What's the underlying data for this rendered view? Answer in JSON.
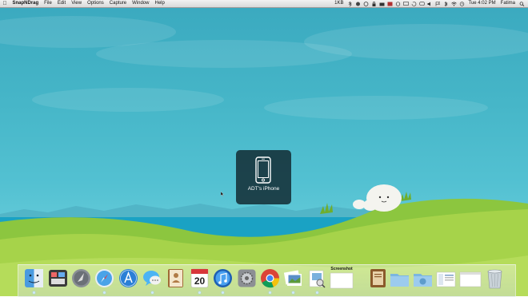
{
  "menubar": {
    "app_name": "SnapNDrag",
    "menus": [
      "File",
      "Edit",
      "View",
      "Options",
      "Capture",
      "Window",
      "Help"
    ],
    "status_text": "1KB",
    "clock": "Tue 4:02 PM",
    "user": "Fatima"
  },
  "device_popup": {
    "device_name": "ADT's iPhone",
    "icon": "iphone-icon"
  },
  "dock": {
    "items": [
      {
        "name": "finder",
        "icon": "finder-icon"
      },
      {
        "name": "mission-control",
        "icon": "mission-control-icon"
      },
      {
        "name": "launchpad",
        "icon": "launchpad-icon"
      },
      {
        "name": "safari",
        "icon": "safari-icon"
      },
      {
        "name": "app-store",
        "icon": "app-store-icon"
      },
      {
        "name": "messages",
        "icon": "messages-icon"
      },
      {
        "name": "contacts",
        "icon": "contacts-icon"
      },
      {
        "name": "calendar",
        "icon": "calendar-icon"
      },
      {
        "name": "itunes",
        "icon": "itunes-icon"
      },
      {
        "name": "system-preferences",
        "icon": "gear-icon"
      },
      {
        "name": "chrome",
        "icon": "chrome-icon"
      },
      {
        "name": "iphoto",
        "icon": "iphoto-icon"
      },
      {
        "name": "preview",
        "icon": "preview-icon"
      },
      {
        "name": "snapndrag",
        "icon": "screenshot-icon"
      },
      {
        "name": "book",
        "icon": "book-icon"
      },
      {
        "name": "documents-folder",
        "icon": "folder-icon"
      },
      {
        "name": "downloads-folder",
        "icon": "downloads-folder-icon"
      },
      {
        "name": "screenshot-thumb",
        "icon": "screenshot-thumbnail-icon"
      },
      {
        "name": "window-thumb",
        "icon": "window-thumbnail-icon"
      },
      {
        "name": "trash",
        "icon": "trash-icon"
      }
    ],
    "calendar_day": "20",
    "screenshot_label": "Screenshot"
  }
}
